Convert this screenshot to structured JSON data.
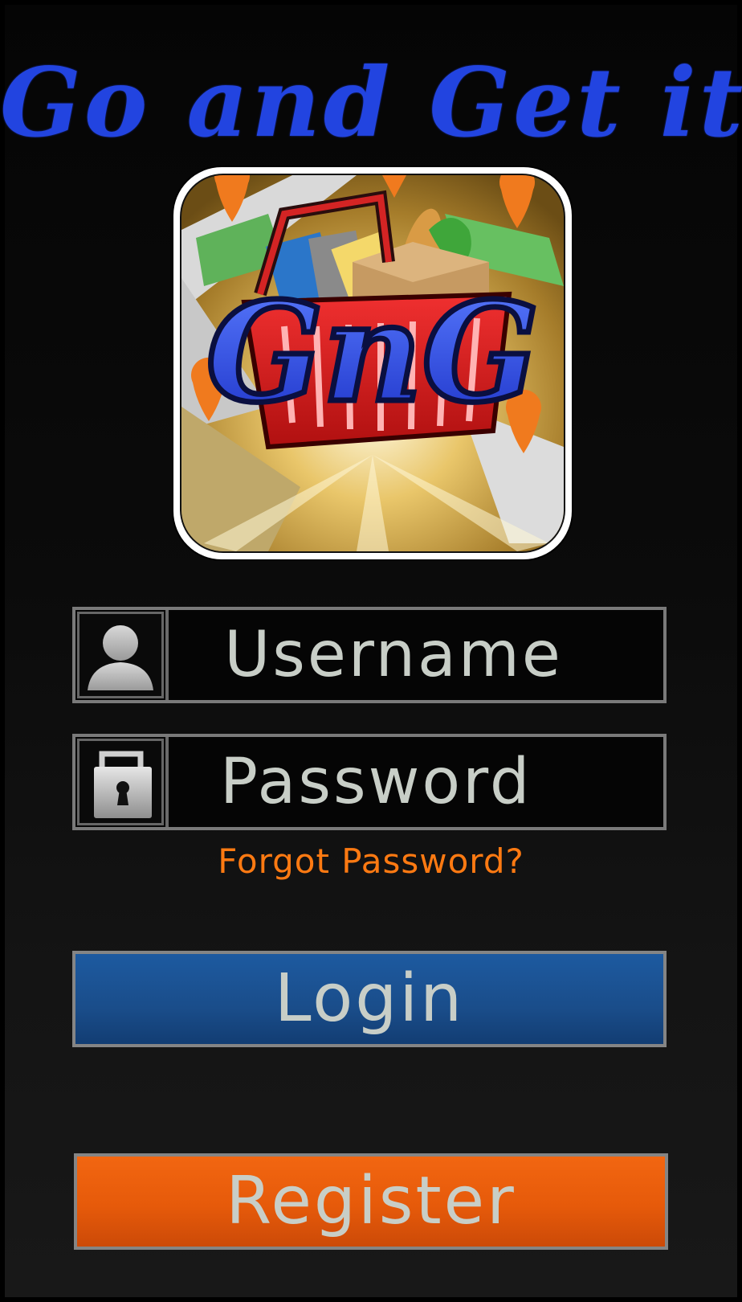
{
  "app": {
    "title": "Go and Get it",
    "logo_text": "GnG"
  },
  "form": {
    "username": {
      "placeholder": "Username",
      "value": "",
      "icon": "user-icon"
    },
    "password": {
      "placeholder": "Password",
      "value": "",
      "icon": "lock-icon"
    },
    "forgot_password_label": "Forgot Password?"
  },
  "actions": {
    "login_label": "Login",
    "register_label": "Register"
  },
  "colors": {
    "title": "#2244e0",
    "forgot_link": "#ff7a12",
    "login_button": "#1a4d8a",
    "register_button": "#e65a0a",
    "field_text": "#c8cec7"
  }
}
